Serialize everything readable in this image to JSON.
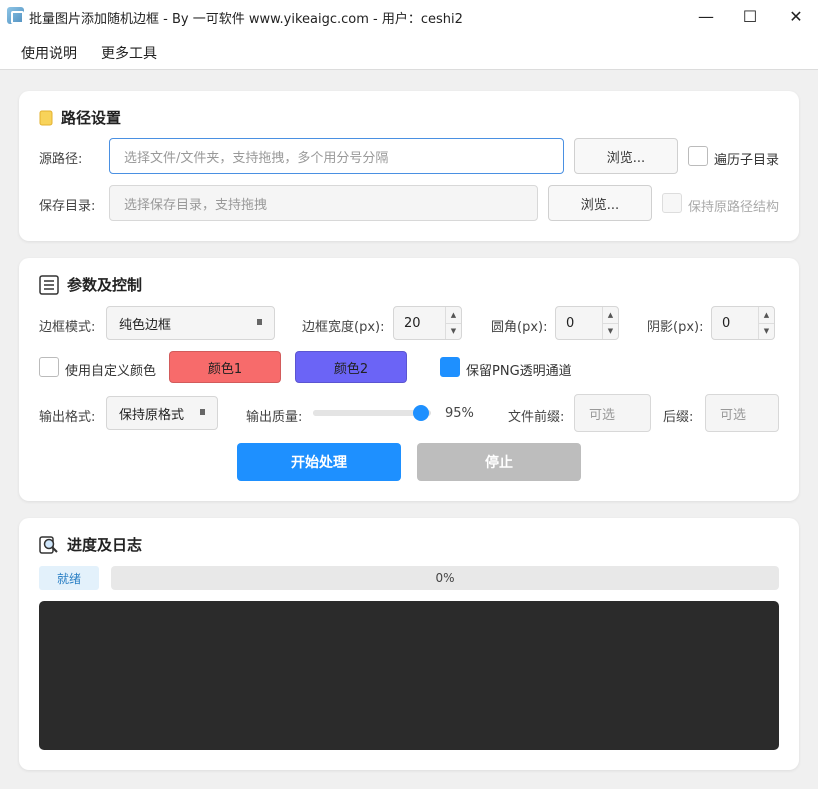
{
  "window": {
    "title": "批量图片添加随机边框 - By 一可软件 www.yikeaigc.com - 用户：ceshi2",
    "minimize_glyph": "—",
    "maximize_glyph": "☐",
    "close_glyph": "✕"
  },
  "menu": {
    "items": [
      "使用说明",
      "更多工具"
    ]
  },
  "path_section": {
    "title": "路径设置",
    "icon": "folder-icon",
    "source_label": "源路径:",
    "source_placeholder": "选择文件/文件夹，支持拖拽，多个用分号分隔",
    "source_browse": "浏览...",
    "recurse_label": "遍历子目录",
    "recurse_checked": false,
    "save_label": "保存目录:",
    "save_placeholder": "选择保存目录，支持拖拽",
    "save_browse": "浏览...",
    "keep_structure_label": "保持原路径结构",
    "keep_structure_checked": false,
    "keep_structure_enabled": false
  },
  "params_section": {
    "title": "参数及控制",
    "icon": "list-icon",
    "border_mode_label": "边框模式:",
    "border_mode_value": "纯色边框",
    "border_width_label": "边框宽度(px):",
    "border_width_value": "20",
    "radius_label": "圆角(px):",
    "radius_value": "0",
    "shadow_label": "阴影(px):",
    "shadow_value": "0",
    "custom_color_label": "使用自定义颜色",
    "custom_color_checked": false,
    "color1_label": "颜色1",
    "color1_hex": "#f76b6b",
    "color2_label": "颜色2",
    "color2_hex": "#6b64f6",
    "keep_png_label": "保留PNG透明通道",
    "keep_png_checked": true,
    "output_format_label": "输出格式:",
    "output_format_value": "保持原格式",
    "quality_label": "输出质量:",
    "quality_value": 95,
    "quality_text": "95%",
    "prefix_label": "文件前缀:",
    "prefix_placeholder": "可选",
    "suffix_label": "后缀:",
    "suffix_placeholder": "可选",
    "start_button": "开始处理",
    "stop_button": "停止"
  },
  "progress_section": {
    "title": "进度及日志",
    "icon": "log-search-icon",
    "status": "就绪",
    "progress_value": 0,
    "progress_text": "0%"
  },
  "colors": {
    "accent": "#1e90ff",
    "stop_disabled": "#bdbdbd",
    "log_background": "#2b2b2b"
  }
}
